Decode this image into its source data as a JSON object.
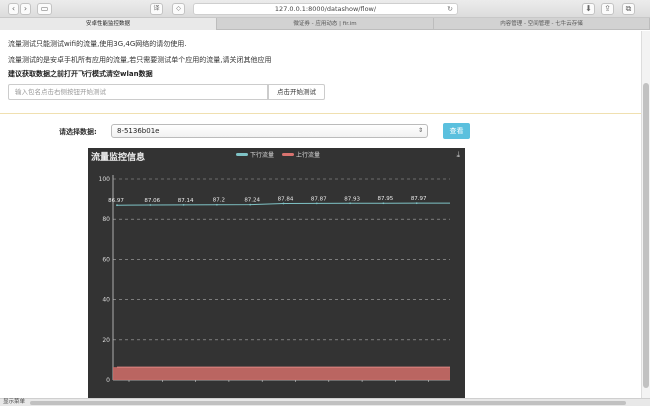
{
  "browser": {
    "url": "127.0.0.1:8000/datashow/flow/",
    "tabs": [
      {
        "label": "安卓性能监控数据",
        "active": true
      },
      {
        "label": "微证券 - 应用动态 | fir.im",
        "active": false
      },
      {
        "label": "内容管理 - 空间管理 - 七牛云存储",
        "active": false
      }
    ],
    "status_text": "显示菜单"
  },
  "page": {
    "line1": "流量测试只能测试wifi的流量,使用3G,4G网络的请勿使用.",
    "line2": "流量测试的是安卓手机所有应用的流量,若只需要测试单个应用的流量,请关闭其他应用",
    "line3": "建议获取数据之前打开飞行模式清空wlan数据",
    "package_placeholder": "输入包名点击右侧按钮开始测试",
    "start_button": "点击开始测试",
    "select_label": "请选择数据:",
    "select_value": "8-5136b01e",
    "query_button": "查看"
  },
  "chart_data": {
    "type": "line",
    "title": "流量监控信息",
    "yticks": [
      "0",
      "20",
      "40",
      "60",
      "80",
      "100"
    ],
    "ylim": [
      0,
      100
    ],
    "series": [
      {
        "name": "下行流量",
        "color": "#7fc3c6",
        "values": [
          86.97,
          87.06,
          87.14,
          87.2,
          87.24,
          87.84,
          87.87,
          87.93,
          87.95,
          87.97
        ],
        "labels": [
          "86.97",
          "87.06",
          "87.14",
          "87.2",
          "87.24",
          "87.84",
          "87.87",
          "87.93",
          "87.95",
          "87.97"
        ]
      },
      {
        "name": "上行流量",
        "color": "#d9736f",
        "values": [
          6.4,
          6.4,
          6.4,
          6.4,
          6.4,
          6.4,
          6.4,
          6.4,
          6.4,
          6.4
        ]
      }
    ],
    "grid": true,
    "legend": "top-center"
  }
}
